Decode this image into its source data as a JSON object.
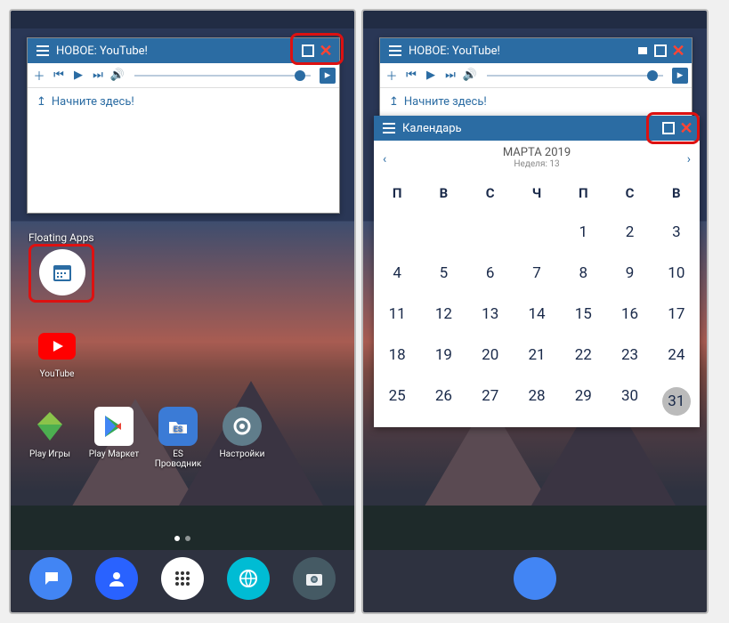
{
  "left": {
    "youtube_win": {
      "title": "НОВОЕ: YouTube!",
      "start_hint": "Начните здесь!"
    },
    "desk_label": "Floating Apps",
    "apps": {
      "youtube": "YouTube",
      "play_games": "Play Игры",
      "play_market": "Play Маркет",
      "es_explorer": "ES Проводник",
      "settings": "Настройки"
    }
  },
  "right": {
    "youtube_win": {
      "title": "НОВОЕ: YouTube!",
      "start_hint": "Начните здесь!"
    },
    "calendar_win": {
      "title": "Календарь",
      "month": "МАРТА 2019",
      "week": "Неделя: 13",
      "dow": [
        "П",
        "В",
        "С",
        "Ч",
        "П",
        "С",
        "В"
      ],
      "days": [
        [
          "",
          "",
          "",
          "",
          "1",
          "2",
          "3"
        ],
        [
          "4",
          "5",
          "6",
          "7",
          "8",
          "9",
          "10"
        ],
        [
          "11",
          "12",
          "13",
          "14",
          "15",
          "16",
          "17"
        ],
        [
          "18",
          "19",
          "20",
          "21",
          "22",
          "23",
          "24"
        ],
        [
          "25",
          "26",
          "27",
          "28",
          "29",
          "30",
          "31"
        ]
      ],
      "today": "31"
    }
  }
}
